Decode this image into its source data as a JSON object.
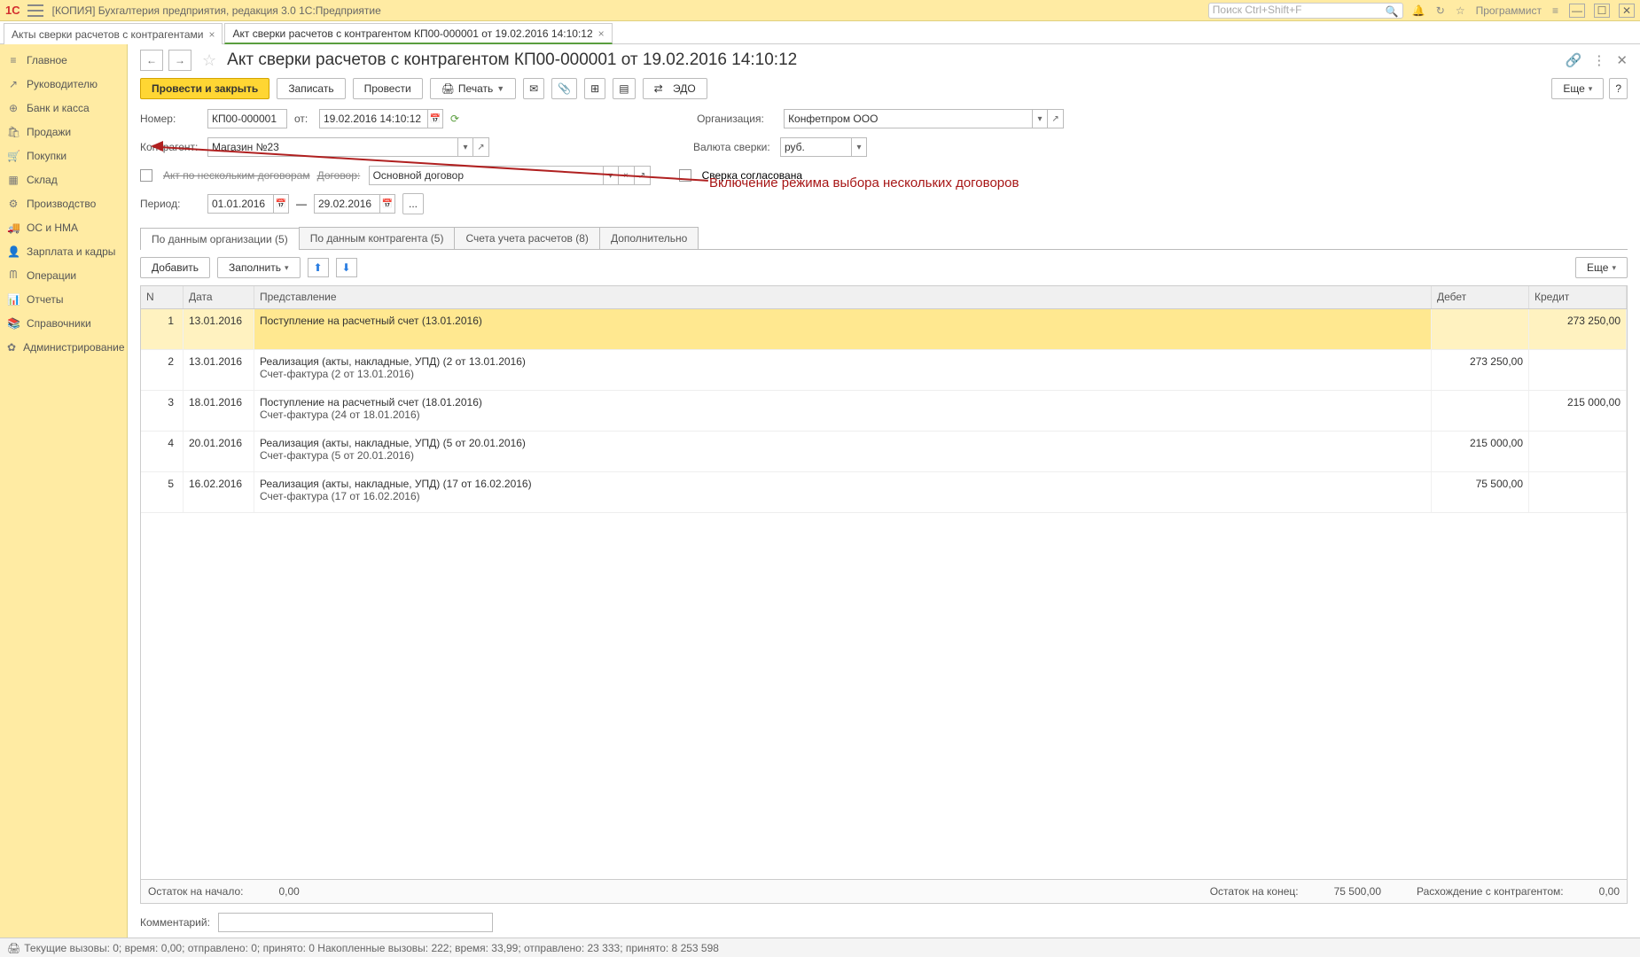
{
  "titlebar": {
    "logo": "1C",
    "title": "[КОПИЯ] Бухгалтерия предприятия, редакция 3.0  1С:Предприятие",
    "search_placeholder": "Поиск Ctrl+Shift+F",
    "user": "Программист"
  },
  "tabs": [
    {
      "label": "Акты сверки расчетов с контрагентами",
      "active": false
    },
    {
      "label": "Акт сверки расчетов с контрагентом КП00-000001 от 19.02.2016 14:10:12",
      "active": true
    }
  ],
  "sidebar": [
    {
      "icon": "≡",
      "label": "Главное"
    },
    {
      "icon": "↗",
      "label": "Руководителю"
    },
    {
      "icon": "⊕",
      "label": "Банк и касса"
    },
    {
      "icon": "🛍",
      "label": "Продажи"
    },
    {
      "icon": "🛒",
      "label": "Покупки"
    },
    {
      "icon": "▦",
      "label": "Склад"
    },
    {
      "icon": "⚙",
      "label": "Производство"
    },
    {
      "icon": "🚚",
      "label": "ОС и НМА"
    },
    {
      "icon": "👤",
      "label": "Зарплата и кадры"
    },
    {
      "icon": "ᗰ",
      "label": "Операции"
    },
    {
      "icon": "📊",
      "label": "Отчеты"
    },
    {
      "icon": "📚",
      "label": "Справочники"
    },
    {
      "icon": "✿",
      "label": "Администрирование"
    }
  ],
  "header": {
    "title": "Акт сверки расчетов с контрагентом КП00-000001 от 19.02.2016 14:10:12"
  },
  "toolbar": {
    "post_close": "Провести и закрыть",
    "write": "Записать",
    "post": "Провести",
    "print": "Печать",
    "edo": "ЭДО",
    "more": "Еще"
  },
  "form": {
    "number_lbl": "Номер:",
    "number": "КП00-000001",
    "from_lbl": "от:",
    "date": "19.02.2016 14:10:12",
    "org_lbl": "Организация:",
    "org": "Конфетпром ООО",
    "counterparty_lbl": "Контрагент:",
    "counterparty": "Магазин №23",
    "currency_lbl": "Валюта сверки:",
    "currency": "руб.",
    "multi_contract_lbl": "Акт по нескольким договорам",
    "contract_lbl": "Договор:",
    "contract": "Основной договор",
    "agreed_lbl": "Сверка согласована",
    "period_lbl": "Период:",
    "period_from": "01.01.2016",
    "period_sep": "—",
    "period_to": "29.02.2016",
    "period_select": "...",
    "comment_lbl": "Комментарий:",
    "comment": ""
  },
  "subtabs": [
    "По данным организации (5)",
    "По данным контрагента (5)",
    "Счета учета расчетов (8)",
    "Дополнительно"
  ],
  "table_ctrls": {
    "add": "Добавить",
    "fill": "Заполнить",
    "more": "Еще"
  },
  "columns": {
    "n": "N",
    "date": "Дата",
    "repr": "Представление",
    "debit": "Дебет",
    "credit": "Кредит"
  },
  "rows": [
    {
      "n": "1",
      "date": "13.01.2016",
      "repr": "Поступление на расчетный счет (13.01.2016)",
      "sub": "",
      "debit": "",
      "credit": "273 250,00",
      "selected": true
    },
    {
      "n": "2",
      "date": "13.01.2016",
      "repr": "Реализация (акты, накладные, УПД) (2 от 13.01.2016)",
      "sub": "Счет-фактура (2 от 13.01.2016)",
      "debit": "273 250,00",
      "credit": ""
    },
    {
      "n": "3",
      "date": "18.01.2016",
      "repr": "Поступление на расчетный счет (18.01.2016)",
      "sub": "Счет-фактура (24 от 18.01.2016)",
      "debit": "",
      "credit": "215 000,00"
    },
    {
      "n": "4",
      "date": "20.01.2016",
      "repr": "Реализация (акты, накладные, УПД) (5 от 20.01.2016)",
      "sub": "Счет-фактура (5 от 20.01.2016)",
      "debit": "215 000,00",
      "credit": ""
    },
    {
      "n": "5",
      "date": "16.02.2016",
      "repr": "Реализация (акты, накладные, УПД) (17 от 16.02.2016)",
      "sub": "Счет-фактура (17 от 16.02.2016)",
      "debit": "75 500,00",
      "credit": ""
    }
  ],
  "summary": {
    "start_lbl": "Остаток на начало:",
    "start_val": "0,00",
    "end_lbl": "Остаток на конец:",
    "end_val": "75 500,00",
    "diff_lbl": "Расхождение с контрагентом:",
    "diff_val": "0,00"
  },
  "status": "Текущие вызовы: 0; время: 0,00; отправлено: 0; принято: 0   Накопленные вызовы: 222; время: 33,99; отправлено: 23 333; принято: 8 253 598",
  "annotation": "Включение режима выбора нескольких договоров"
}
